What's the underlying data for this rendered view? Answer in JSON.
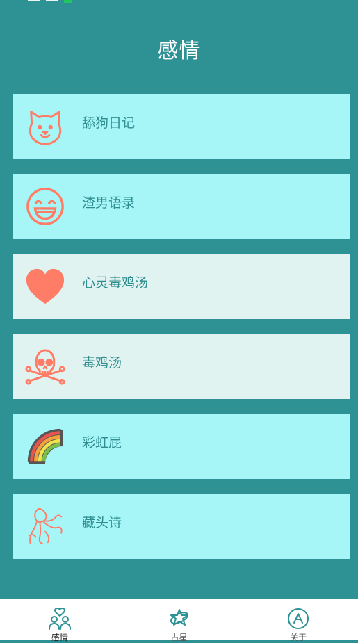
{
  "header": {
    "title": "感情"
  },
  "items": [
    {
      "label": "舔狗日记",
      "icon": "dog-face-icon",
      "bg": "#a6f5f7"
    },
    {
      "label": "渣男语录",
      "icon": "laughing-face-icon",
      "bg": "#a6f5f7"
    },
    {
      "label": "心灵毒鸡汤",
      "icon": "heart-icon",
      "bg": "#e0f3f1"
    },
    {
      "label": "毒鸡汤",
      "icon": "skull-crossbones-icon",
      "bg": "#e0f3f1"
    },
    {
      "label": "彩虹屁",
      "icon": "rainbow-icon",
      "bg": "#a6f5f7"
    },
    {
      "label": "藏头诗",
      "icon": "poem-scroll-icon",
      "bg": "#a6f5f7"
    }
  ],
  "nav": [
    {
      "label": "感情",
      "icon": "couple-heart-icon",
      "active": true
    },
    {
      "label": "占星",
      "icon": "star-orbit-icon",
      "active": false
    },
    {
      "label": "关于",
      "icon": "about-a-icon",
      "active": false
    }
  ],
  "colors": {
    "background": "#2e9193",
    "accent": "#ff7d66",
    "text": "#2f8d8f"
  }
}
